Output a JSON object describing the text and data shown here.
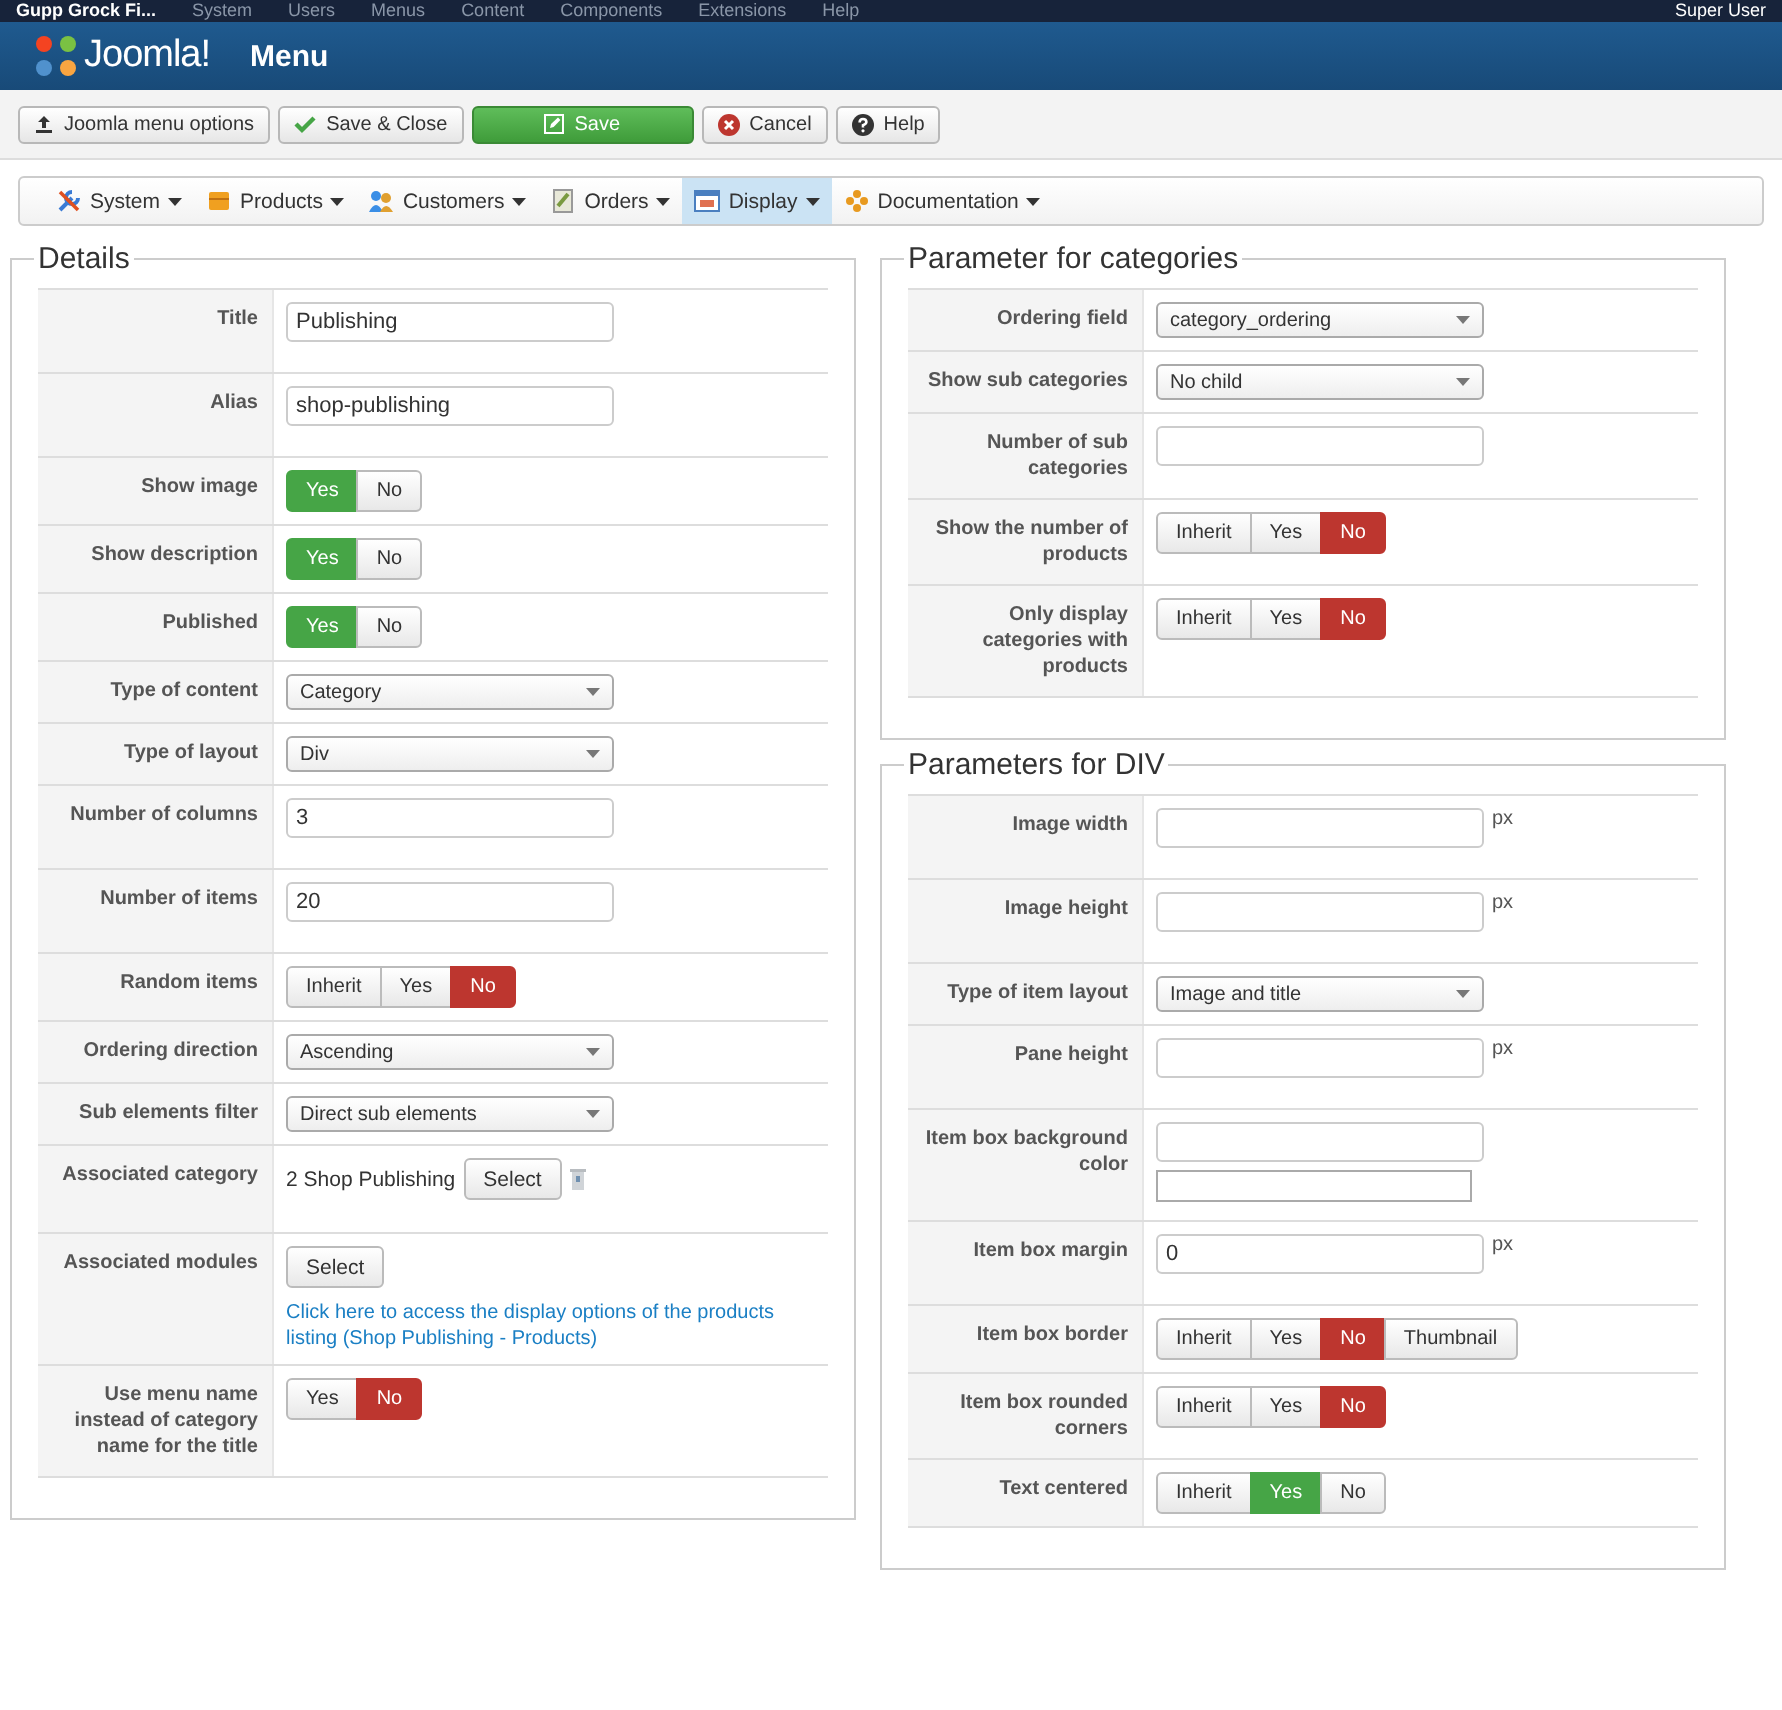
{
  "top_nav": {
    "site": "Gupp Grock Fi...",
    "items": [
      "System",
      "Users",
      "Menus",
      "Content",
      "Components",
      "Extensions",
      "Help"
    ],
    "user": "Super User"
  },
  "header": {
    "logo": "Joomla!",
    "title": "Menu"
  },
  "toolbar": [
    {
      "label": "Joomla menu options",
      "kind": "options"
    },
    {
      "label": "Save & Close",
      "kind": "save_close"
    },
    {
      "label": "Save",
      "kind": "save"
    },
    {
      "label": "Cancel",
      "kind": "cancel"
    },
    {
      "label": "Help",
      "kind": "help"
    }
  ],
  "submenu": [
    {
      "label": "System",
      "kind": "system",
      "selected": false
    },
    {
      "label": "Products",
      "kind": "products",
      "selected": false
    },
    {
      "label": "Customers",
      "kind": "customers",
      "selected": false
    },
    {
      "label": "Orders",
      "kind": "orders",
      "selected": false
    },
    {
      "label": "Display",
      "kind": "display",
      "selected": true
    },
    {
      "label": "Documentation",
      "kind": "documentation",
      "selected": false
    }
  ],
  "columns": [
    {
      "panels": [
        {
          "legend": "Details",
          "fields": [
            {
              "label": "Title",
              "kind": "text",
              "value": "Publishing"
            },
            {
              "label": "Alias",
              "kind": "text",
              "value": "shop-publishing"
            },
            {
              "label": "Show image",
              "kind": "toggle",
              "options": [
                {
                  "label": "Yes",
                  "selected": true,
                  "color": "#46a546"
                },
                {
                  "label": "No",
                  "selected": false
                }
              ]
            },
            {
              "label": "Show description",
              "kind": "toggle",
              "options": [
                {
                  "label": "Yes",
                  "selected": true,
                  "color": "#46a546"
                },
                {
                  "label": "No",
                  "selected": false
                }
              ]
            },
            {
              "label": "Published",
              "kind": "toggle",
              "options": [
                {
                  "label": "Yes",
                  "selected": true,
                  "color": "#46a546"
                },
                {
                  "label": "No",
                  "selected": false
                }
              ]
            },
            {
              "label": "Type of content",
              "kind": "select",
              "value": "Category"
            },
            {
              "label": "Type of layout",
              "kind": "select",
              "value": "Div"
            },
            {
              "label": "Number of columns",
              "kind": "text",
              "value": "3"
            },
            {
              "label": "Number of items",
              "kind": "text",
              "value": "20"
            },
            {
              "label": "Random items",
              "kind": "toggle",
              "options": [
                {
                  "label": "Inherit",
                  "selected": false
                },
                {
                  "label": "Yes",
                  "selected": false
                },
                {
                  "label": "No",
                  "selected": true,
                  "color": "#bd362f"
                }
              ]
            },
            {
              "label": "Ordering direction",
              "kind": "select",
              "value": "Ascending"
            },
            {
              "label": "Sub elements filter",
              "kind": "select",
              "value": "Direct sub elements"
            },
            {
              "label": "Associated category",
              "kind": "category",
              "value": "2 Shop Publishing",
              "button": "Select"
            },
            {
              "label": "Associated modules",
              "kind": "modules",
              "button": "Select",
              "link": "Click here to access the display options of the products listing (Shop Publishing - Products)"
            },
            {
              "label": "Use menu name instead of category name for the title",
              "kind": "toggle",
              "options": [
                {
                  "label": "Yes",
                  "selected": false
                },
                {
                  "label": "No",
                  "selected": true,
                  "color": "#bd362f"
                }
              ]
            }
          ]
        }
      ]
    },
    {
      "panels": [
        {
          "legend": "Parameter for categories",
          "fields": [
            {
              "label": "Ordering field",
              "kind": "select",
              "value": "category_ordering"
            },
            {
              "label": "Show sub categories",
              "kind": "select",
              "value": "No child"
            },
            {
              "label": "Number of sub categories",
              "kind": "text"
            },
            {
              "label": "Show the number of products",
              "kind": "toggle",
              "options": [
                {
                  "label": "Inherit",
                  "selected": false
                },
                {
                  "label": "Yes",
                  "selected": false
                },
                {
                  "label": "No",
                  "selected": true,
                  "color": "#bd362f"
                }
              ]
            },
            {
              "label": "Only display categories with products",
              "kind": "toggle",
              "options": [
                {
                  "label": "Inherit",
                  "selected": false
                },
                {
                  "label": "Yes",
                  "selected": false
                },
                {
                  "label": "No",
                  "selected": true,
                  "color": "#bd362f"
                }
              ]
            }
          ]
        },
        {
          "legend": "Parameters for DIV",
          "fields": [
            {
              "label": "Image width",
              "kind": "text",
              "unit": "px"
            },
            {
              "label": "Image height",
              "kind": "text",
              "unit": "px"
            },
            {
              "label": "Type of item layout",
              "kind": "select",
              "value": "Image and title"
            },
            {
              "label": "Pane height",
              "kind": "text",
              "unit": "px"
            },
            {
              "label": "Item box background color",
              "kind": "color"
            },
            {
              "label": "Item box margin",
              "kind": "text",
              "value": "0",
              "unit": "px"
            },
            {
              "label": "Item box border",
              "kind": "toggle",
              "options": [
                {
                  "label": "Inherit",
                  "selected": false
                },
                {
                  "label": "Yes",
                  "selected": false
                },
                {
                  "label": "No",
                  "selected": true,
                  "color": "#bd362f"
                },
                {
                  "label": "Thumbnail",
                  "selected": false
                }
              ]
            },
            {
              "label": "Item box rounded corners",
              "kind": "toggle",
              "options": [
                {
                  "label": "Inherit",
                  "selected": false
                },
                {
                  "label": "Yes",
                  "selected": false
                },
                {
                  "label": "No",
                  "selected": true,
                  "color": "#bd362f"
                }
              ]
            },
            {
              "label": "Text centered",
              "kind": "toggle",
              "options": [
                {
                  "label": "Inherit",
                  "selected": false
                },
                {
                  "label": "Yes",
                  "selected": true,
                  "color": "#46a546"
                },
                {
                  "label": "No",
                  "selected": false
                }
              ]
            }
          ]
        }
      ]
    }
  ]
}
